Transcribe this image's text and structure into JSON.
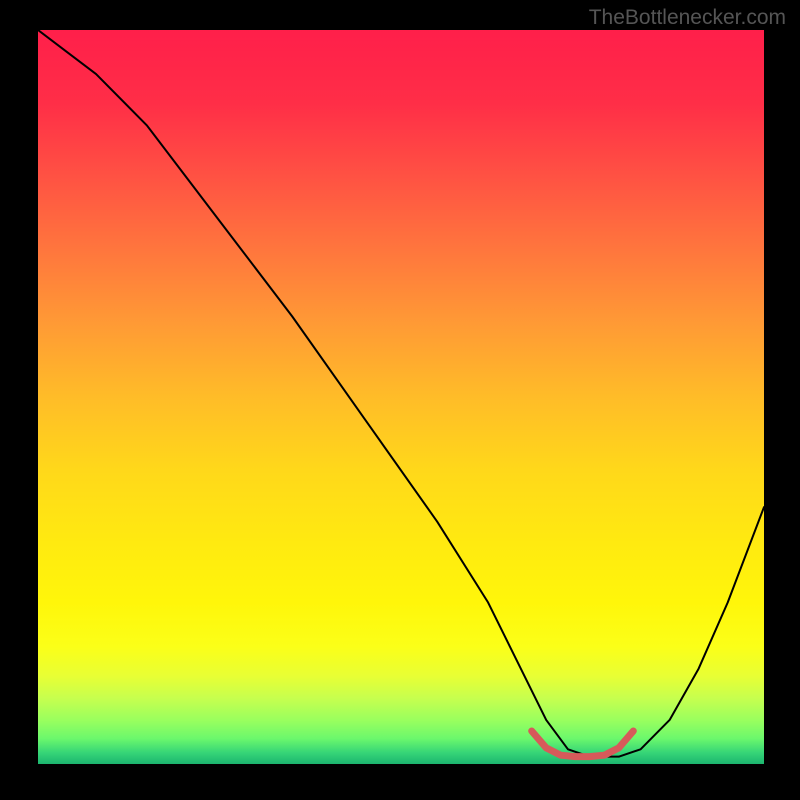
{
  "watermark": "TheBottleneсker.com",
  "chart_data": {
    "type": "line",
    "title": "",
    "xlabel": "",
    "ylabel": "",
    "xlim": [
      0,
      100
    ],
    "ylim": [
      0,
      100
    ],
    "background_gradient": {
      "stops": [
        {
          "offset": 0.0,
          "color": "#ff1f4a"
        },
        {
          "offset": 0.1,
          "color": "#ff2e47"
        },
        {
          "offset": 0.2,
          "color": "#ff5243"
        },
        {
          "offset": 0.3,
          "color": "#ff763d"
        },
        {
          "offset": 0.4,
          "color": "#ff9a35"
        },
        {
          "offset": 0.5,
          "color": "#ffbc28"
        },
        {
          "offset": 0.6,
          "color": "#ffd81a"
        },
        {
          "offset": 0.7,
          "color": "#ffea10"
        },
        {
          "offset": 0.78,
          "color": "#fff60a"
        },
        {
          "offset": 0.84,
          "color": "#fbff18"
        },
        {
          "offset": 0.88,
          "color": "#e8ff34"
        },
        {
          "offset": 0.91,
          "color": "#c7ff4e"
        },
        {
          "offset": 0.94,
          "color": "#9aff5e"
        },
        {
          "offset": 0.965,
          "color": "#6cf86c"
        },
        {
          "offset": 0.985,
          "color": "#35d477"
        },
        {
          "offset": 1.0,
          "color": "#1cb56f"
        }
      ]
    },
    "series": [
      {
        "name": "bottleneck-curve",
        "color": "#000000",
        "width": 2,
        "x": [
          0,
          4,
          8,
          15,
          25,
          35,
          45,
          55,
          62,
          67,
          70,
          73,
          76,
          80,
          83,
          87,
          91,
          95,
          100
        ],
        "y": [
          100,
          97,
          94,
          87,
          74,
          61,
          47,
          33,
          22,
          12,
          6,
          2,
          1,
          1,
          2,
          6,
          13,
          22,
          35
        ]
      },
      {
        "name": "optimal-range-marker",
        "color": "#d65a5a",
        "width": 7,
        "x": [
          68,
          70,
          72,
          74,
          76,
          78,
          80,
          82
        ],
        "y": [
          4.5,
          2.2,
          1.2,
          1.0,
          1.0,
          1.2,
          2.2,
          4.5
        ]
      }
    ]
  }
}
